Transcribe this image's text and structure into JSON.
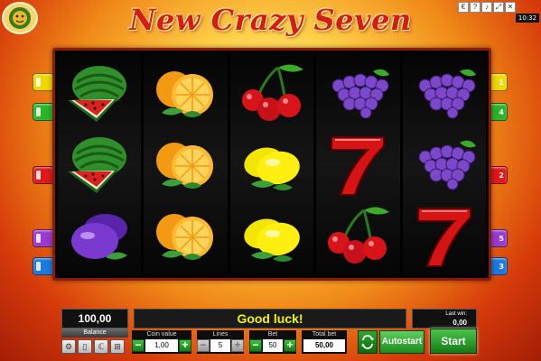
{
  "game": {
    "title": "New Crazy Seven",
    "clock": "10:32",
    "sys_icons": [
      "€",
      "?",
      "♪",
      "⤢",
      "✕"
    ]
  },
  "reels": [
    [
      "watermelon",
      "watermelon",
      "plum"
    ],
    [
      "orange",
      "orange",
      "orange"
    ],
    [
      "cherry",
      "lemon",
      "lemon"
    ],
    [
      "grapes",
      "seven",
      "cherry"
    ],
    [
      "grapes",
      "grapes",
      "seven"
    ]
  ],
  "line_markers": {
    "left": [
      {
        "label": "1",
        "color": "yellow"
      },
      {
        "label": "4",
        "color": "green"
      },
      {
        "label": "2",
        "color": "red"
      },
      {
        "label": "5",
        "color": "purple"
      },
      {
        "label": "3",
        "color": "blue"
      }
    ],
    "right": [
      {
        "label": "1",
        "color": "yellow"
      },
      {
        "label": "4",
        "color": "green"
      },
      {
        "label": "2",
        "color": "red"
      },
      {
        "label": "5",
        "color": "purple"
      },
      {
        "label": "3",
        "color": "blue"
      }
    ]
  },
  "panel": {
    "balance_value": "100,00",
    "balance_label": "Balance",
    "message": "Good luck!",
    "last_win_label": "Last win:",
    "last_win_value": "0,00",
    "coin_value_label": "Coin value",
    "coin_value": "1,00",
    "lines_label": "Lines",
    "lines_value": "5",
    "bet_label": "Bet",
    "bet_value": "50",
    "total_bet_label": "Total bet",
    "total_bet_value": "50,00",
    "autostart_label": "Autostart",
    "start_label": "Start",
    "minus": "−",
    "plus": "+",
    "util_icons": [
      "⚙",
      "▯",
      "ℂ",
      "⊞"
    ]
  },
  "colors": {
    "title": "#d41e14",
    "message": "#f4f400",
    "button_green": "#2ab52a",
    "frame": "#8a1b0c"
  }
}
